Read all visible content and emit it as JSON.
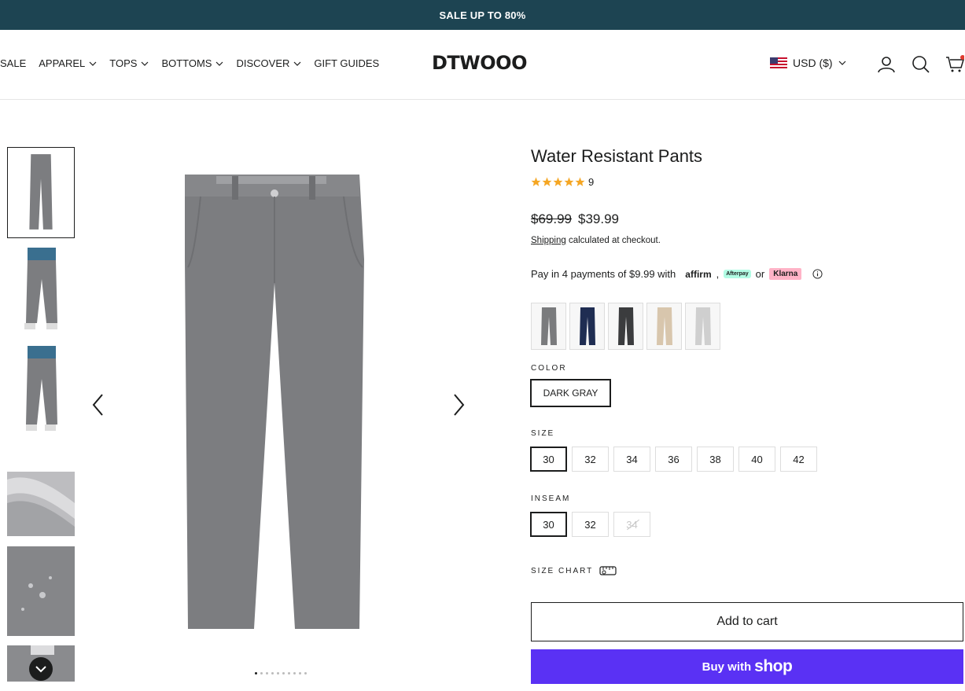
{
  "announcement": "SALE UP TO 80%",
  "nav": {
    "items": [
      {
        "label": "SALE",
        "dropdown": false
      },
      {
        "label": "APPAREL",
        "dropdown": true
      },
      {
        "label": "TOPS",
        "dropdown": true
      },
      {
        "label": "BOTTOMS",
        "dropdown": true
      },
      {
        "label": "DISCOVER",
        "dropdown": true
      },
      {
        "label": "GIFT GUIDES",
        "dropdown": false
      }
    ]
  },
  "logo": "DTWOOO",
  "currency": {
    "label": "USD ($)",
    "flag": "us-flag-icon"
  },
  "product": {
    "title": "Water Resistant Pants",
    "rating_count": "9",
    "rating_value": 5,
    "compare_price": "$69.99",
    "price": "$39.99",
    "shipping_link": "Shipping",
    "shipping_text": " calculated at checkout.",
    "pay4_text": "Pay in 4 payments of $9.99 with",
    "affirm": "affirm",
    "comma": ",",
    "afterpay": "Afterpay",
    "or": "or",
    "klarna": "Klarna",
    "color_label": "COLOR",
    "color_value": "DARK GRAY",
    "size_label": "SIZE",
    "sizes": [
      {
        "label": "30",
        "selected": true,
        "available": true
      },
      {
        "label": "32",
        "selected": false,
        "available": true
      },
      {
        "label": "34",
        "selected": false,
        "available": true
      },
      {
        "label": "36",
        "selected": false,
        "available": true
      },
      {
        "label": "38",
        "selected": false,
        "available": true
      },
      {
        "label": "40",
        "selected": false,
        "available": true
      },
      {
        "label": "42",
        "selected": false,
        "available": true
      }
    ],
    "inseam_label": "INSEAM",
    "inseams": [
      {
        "label": "30",
        "selected": true,
        "available": true
      },
      {
        "label": "32",
        "selected": false,
        "available": true
      },
      {
        "label": "34",
        "selected": false,
        "available": false
      }
    ],
    "size_chart": "SIZE CHART",
    "add_to_cart": "Add to cart",
    "buy_with": "Buy with",
    "shop": "shop",
    "swatch_colors": [
      "#7a7b7d",
      "#1f2d52",
      "#3b3c3e",
      "#d8c6ad",
      "#cfcfcf"
    ]
  },
  "colors": {
    "announcement_bg": "#1d4452",
    "star": "#f5a623",
    "shop_pay": "#5a31f4",
    "pants": "#7c7d80"
  }
}
